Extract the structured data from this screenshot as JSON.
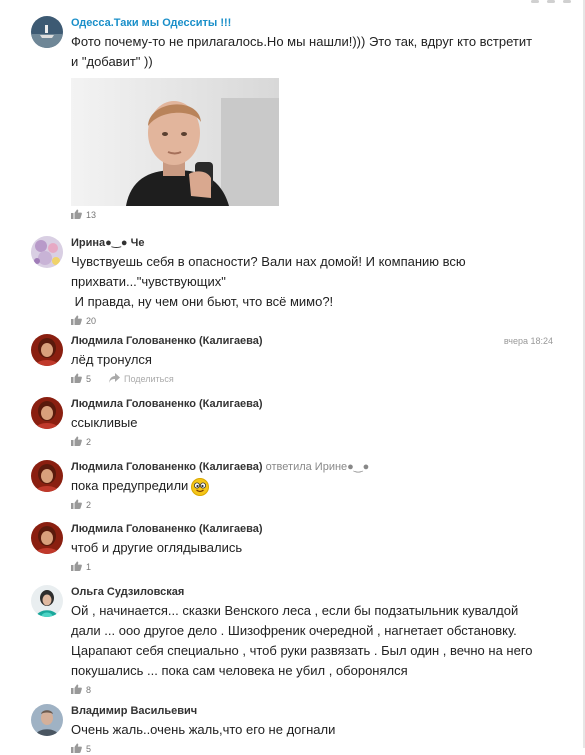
{
  "comments": [
    {
      "author": "Одесса.Таки мы Одесситы !!!",
      "text": "Фото почему-то не прилагалось.Но мы нашли!))) Это так, вдруг кто встретит\nи \"добавит\" ))",
      "likes": "13"
    },
    {
      "author": "Ирина●‿● Че",
      "text": "Чувствуешь себя в опасности? Вали нах домой! И компанию всю\nприхвати...\"чувствующих\"\n И правда, ну чем они бьют, что всё мимо?!",
      "likes": "20"
    },
    {
      "author": "Людмила Голованенко (Калигаева)",
      "time": "вчера 18:24",
      "text": "лёд тронулся",
      "likes": "5",
      "share_label": "Поделиться"
    },
    {
      "author": "Людмила Голованенко (Калигаева)",
      "text": "ссыкливые",
      "likes": "2"
    },
    {
      "author": "Людмила Голованенко (Калигаева)",
      "reply_to": "ответила Ирине●‿●",
      "text": "пока предупредили",
      "likes": "2"
    },
    {
      "author": "Людмила Голованенко (Калигаева)",
      "text": "чтоб и другие оглядывались",
      "likes": "1"
    },
    {
      "author": "Ольга Судзиловская",
      "text": "Ой , начинается... сказки Венского леса , если бы подзатыльник кувалдой\nдали ... ооо другое дело . Шизофреник очередной , нагнетает обстановку.\nЦарапают себя специально , чтоб руки развязать . Был один , вечно на него\nпокушались ... пока сам человека не убил , оборонялся",
      "likes": "8"
    },
    {
      "author": "Владимир Васильевич",
      "text": "Очень жаль..очень жаль,что его не догнали",
      "likes": "5"
    }
  ],
  "colors": {
    "accent": "#1a8fc9",
    "text": "#222222",
    "meta": "#777777"
  }
}
